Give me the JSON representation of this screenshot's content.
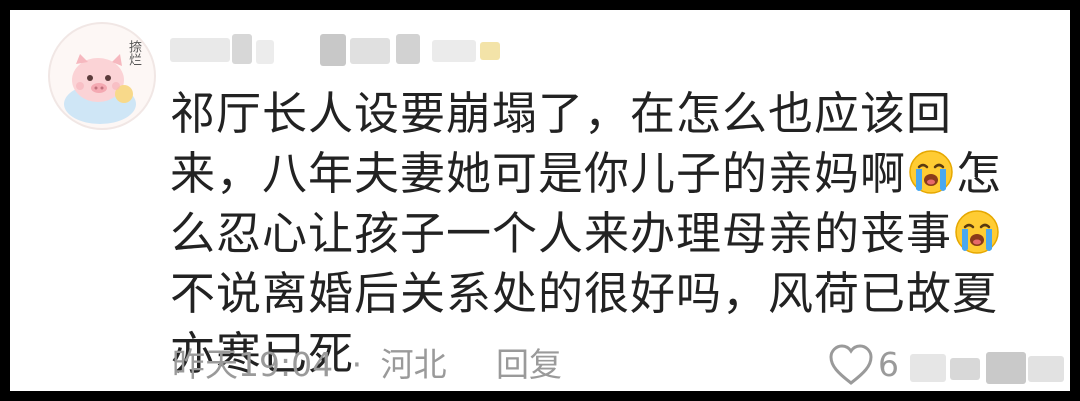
{
  "avatar": {
    "badge_text": "捺烂"
  },
  "comment": {
    "segments": [
      {
        "type": "text",
        "value": "祁厅长人设要崩塌了，在怎么也应该回来，八年夫妻她可是你儿子的亲妈啊"
      },
      {
        "type": "emoji",
        "icon": "loudly-crying-face-icon"
      },
      {
        "type": "text",
        "value": "怎么忍心让孩子一个人来办理母亲的丧事"
      },
      {
        "type": "emoji",
        "icon": "loudly-crying-face-icon"
      },
      {
        "type": "text",
        "value": "不说离婚后关系处的很好吗，风荷已故夏亦寒已死"
      }
    ]
  },
  "meta": {
    "time": "昨天19:04",
    "separator": "·",
    "location": "河北",
    "reply_label": "回复",
    "likes_count": "6"
  },
  "colors": {
    "text": "#222222",
    "meta": "#9a9a9a",
    "card_bg": "#ffffff",
    "frame": "#000000"
  }
}
